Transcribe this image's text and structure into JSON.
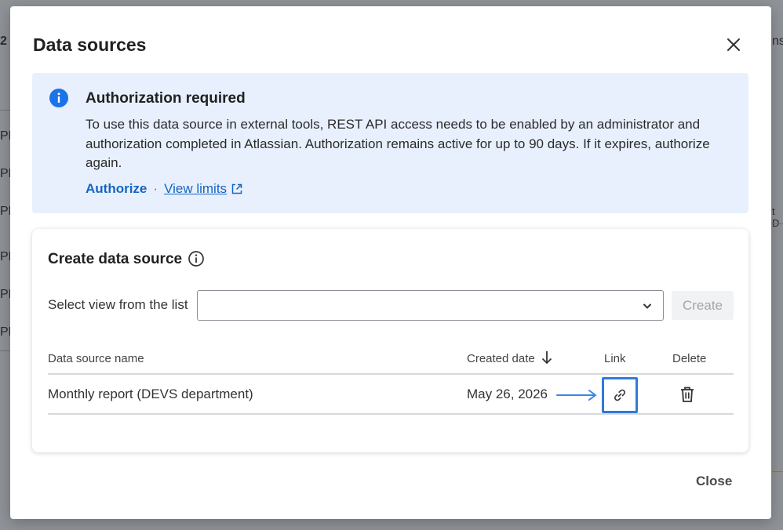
{
  "backdrop": {
    "fragments": [
      "2",
      "ns",
      "PM",
      "PM",
      "PM",
      "PM",
      "PM",
      "PM",
      "t D"
    ]
  },
  "modal": {
    "title": "Data sources",
    "close_icon": "close-icon",
    "footer_close_label": "Close"
  },
  "banner": {
    "icon": "info-icon",
    "title": "Authorization required",
    "text": "To use this data source in external tools, REST API access needs to be enabled by an administrator and authorization completed in Atlassian. Authorization remains active for up to 90 days. If it expires, authorize again.",
    "authorize_label": "Authorize",
    "separator": "·",
    "view_limits_label": "View limits",
    "external_icon": "external-link-icon"
  },
  "card": {
    "title": "Create data source",
    "help_icon": "info-outline-icon",
    "select_label": "Select view from the list",
    "select_value": "",
    "create_label": "Create",
    "table": {
      "columns": [
        "Data source name",
        "Created date",
        "Link",
        "Delete"
      ],
      "sort_icon": "arrow-down-icon",
      "rows": [
        {
          "name": "Monthly report (DEVS department)",
          "created": "May 26, 2026",
          "link_icon": "link-icon",
          "delete_icon": "trash-icon"
        }
      ]
    }
  },
  "colors": {
    "accent": "#1a73e8",
    "link": "#1565c0",
    "banner_bg": "#e8f0fd",
    "highlight_border": "#2f7bd8"
  }
}
